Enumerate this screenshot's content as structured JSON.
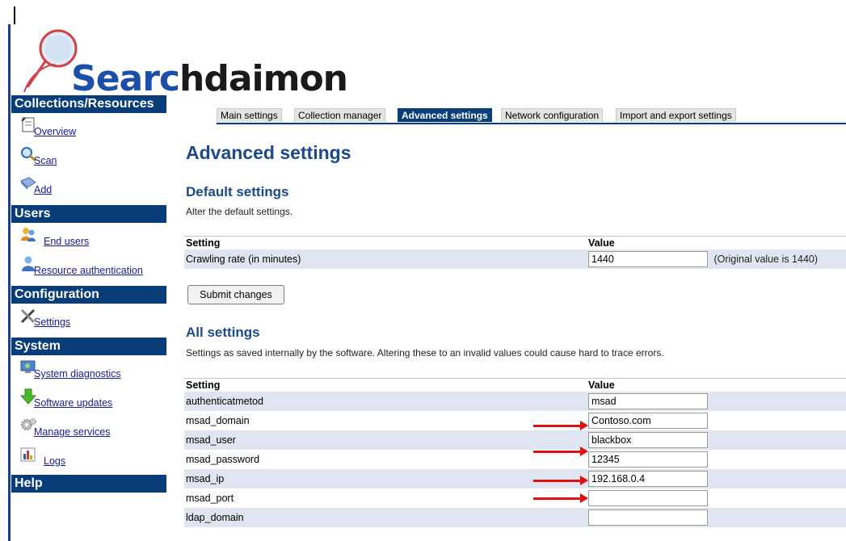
{
  "logo": {
    "text_blue": "Searc",
    "text_dark": "hdaimon"
  },
  "sidebar": {
    "sections": [
      {
        "title": "Collections/Resources",
        "items": [
          {
            "label": "Overview",
            "icon": "overview-icon"
          },
          {
            "label": "Scan",
            "icon": "magnifier-icon"
          },
          {
            "label": "Add",
            "icon": "add-icon"
          }
        ]
      },
      {
        "title": "Users",
        "items": [
          {
            "label": "End users",
            "icon": "users-icon"
          },
          {
            "label": "Resource authentication",
            "icon": "user-key-icon"
          }
        ]
      },
      {
        "title": "Configuration",
        "items": [
          {
            "label": "Settings",
            "icon": "tools-icon"
          }
        ]
      },
      {
        "title": "System",
        "items": [
          {
            "label": "System diagnostics",
            "icon": "diagnostics-icon"
          },
          {
            "label": "Software updates",
            "icon": "download-arrow-icon"
          },
          {
            "label": "Manage services",
            "icon": "gears-icon"
          },
          {
            "label": "Logs",
            "icon": "chart-icon"
          }
        ]
      },
      {
        "title": "Help",
        "items": []
      }
    ]
  },
  "tabs": [
    {
      "label": "Main settings",
      "active": false
    },
    {
      "label": "Collection manager",
      "active": false
    },
    {
      "label": "Advanced settings",
      "active": true
    },
    {
      "label": "Network configuration",
      "active": false
    },
    {
      "label": "Import and export settings",
      "active": false
    }
  ],
  "page": {
    "title": "Advanced settings",
    "default_section": {
      "title": "Default settings",
      "description": "Alter the default settings.",
      "col_setting": "Setting",
      "col_value": "Value",
      "rows": [
        {
          "setting": "Crawling rate (in minutes)",
          "value": "1440",
          "note": "(Original value is 1440)"
        }
      ],
      "submit_label": "Submit changes"
    },
    "all_section": {
      "title": "All settings",
      "description": "Settings as saved internally by the software. Altering these to an invalid values could cause hard to trace errors.",
      "col_setting": "Setting",
      "col_value": "Value",
      "rows": [
        {
          "setting": "authenticatmetod",
          "value": "msad"
        },
        {
          "setting": "msad_domain",
          "value": "Contoso.com"
        },
        {
          "setting": "msad_user",
          "value": "blackbox"
        },
        {
          "setting": "msad_password",
          "value": "12345"
        },
        {
          "setting": "msad_ip",
          "value": "192.168.0.4"
        },
        {
          "setting": "msad_port",
          "value": ""
        },
        {
          "setting": "ldap_domain",
          "value": ""
        }
      ]
    }
  },
  "colors": {
    "nav_header": "#083d7a",
    "heading": "#1b4a8c",
    "row_alt": "#dfe6f2",
    "annotation_arrow": "#e01010"
  }
}
